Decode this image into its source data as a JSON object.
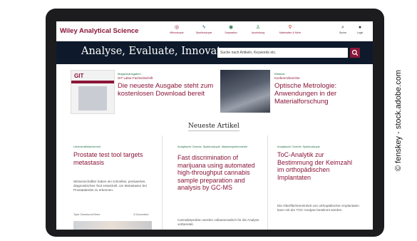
{
  "site": {
    "logo": "Wiley Analytical Science",
    "nav": [
      {
        "label": "Mikroskopie",
        "icon": "microscope-icon",
        "glyph": "◎"
      },
      {
        "label": "Spektroskopie",
        "icon": "spectrum-icon",
        "glyph": "ϟ"
      },
      {
        "label": "Separation",
        "icon": "separation-icon",
        "glyph": "◉"
      },
      {
        "label": "Ausrüstung",
        "icon": "equipment-icon",
        "glyph": "♙"
      },
      {
        "label": "Materialien & Mehr",
        "icon": "materials-icon",
        "glyph": "⚲"
      }
    ],
    "nav_right": [
      {
        "label": "Suche",
        "icon": "search-icon",
        "glyph": "⌕"
      },
      {
        "label": "Login",
        "icon": "user-icon",
        "glyph": "●"
      }
    ]
  },
  "hero": {
    "tagline": "Analyse, Evaluate, Innovate",
    "search_placeholder": "Suche nach Artikeln, Keywords etc."
  },
  "featured": [
    {
      "kicker": "Magazinausgaben",
      "subtitle": "GIT Labor-Fachzeitschrift",
      "title": "Die neueste Ausgabe steht zum kostenlosen Download bereit",
      "image_label": "GIT"
    },
    {
      "kicker": "Webinar",
      "subtitle": "Konferenzberichte",
      "title": "Optische Metrologie: Anwendungen in der Materialforschung"
    }
  ],
  "section": {
    "title": "Neueste Artikel"
  },
  "articles": [
    {
      "category": "Lebensmittelsicherheit",
      "title": "Prostate test tool targets metastasis",
      "text": "Wissenschaftler haben ein schnelles, preiswertes, diagnostisches Tool entwickelt, um Metastasen bei Prostatakrebs zu erkennen.",
      "author": "Tyler Dewhurst-Rees",
      "date": "3 Dezember"
    },
    {
      "category": "Analytische Chemie, Spektroskopie, Massenspektrometrie",
      "title": "Fast discrimination of marijuana using automated high-throughput cannabis sample preparation and analysis by GC-MS",
      "text": "Cannabisproben werden vollautomatisch für die Analyse vorbereitet."
    },
    {
      "category": "Analytische Chemie, Spektroskopie",
      "title": "ToC-Analytik zur Bestimmung der Keimzahl im orthopädischen Implantaten",
      "text": "Die Oberflächenreinheit von orthopädischen Implantaten kann mit der TOC-Analyse bestimmt werden."
    }
  ],
  "credit": "© fenskey - stock.adobe.com",
  "colors": {
    "brand": "#8a1538",
    "hero_bg": "#0e1a2b",
    "kicker": "#1f6e43",
    "laptop_frame": "#1c1c1e"
  }
}
